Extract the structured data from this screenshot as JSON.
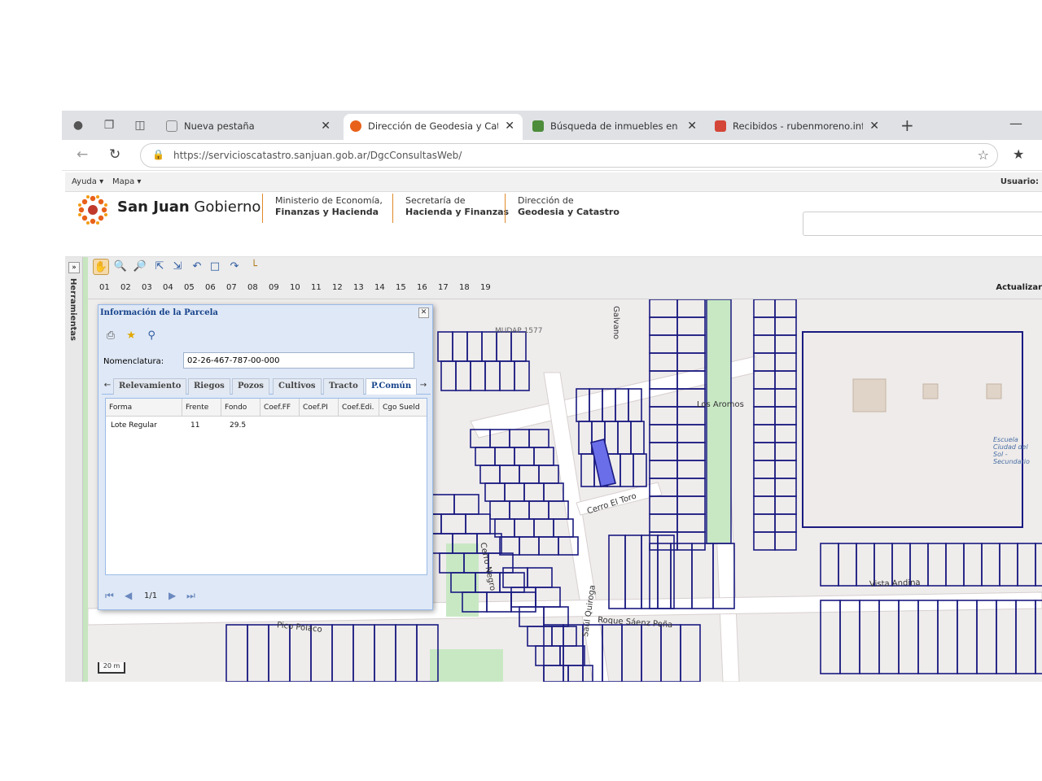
{
  "browser": {
    "tabs": [
      {
        "title": "Nueva pestaña",
        "active": false,
        "favicon_color": "#8a8a8a"
      },
      {
        "title": "Dirección de Geodesia y Catastro",
        "active": true,
        "favicon_color": "#e8611a"
      },
      {
        "title": "Búsqueda de inmuebles en mapa",
        "active": false,
        "favicon_color": "#4c8c3a"
      },
      {
        "title": "Recibidos - rubenmoreno.info@g",
        "active": false,
        "favicon_color": "#d44638"
      }
    ],
    "close_glyph": "✕",
    "new_tab_glyph": "+",
    "minimize_glyph": "—",
    "url": "https://servicioscatastro.sanjuan.gob.ar/DgcConsultasWeb/"
  },
  "menu": {
    "ayuda": "Ayuda ▾",
    "mapa": "Mapa ▾",
    "usuario": "Usuario:"
  },
  "header": {
    "brand_strong": "San Juan",
    "brand_light": "Gobierno",
    "orgs": [
      {
        "line1": "Ministerio de Economía,",
        "line2": "Finanzas y Hacienda"
      },
      {
        "line1": "Secretaría de",
        "line2": "Hacienda y Finanzas"
      },
      {
        "line1": "Dirección de",
        "line2": "Geodesia y Catastro"
      }
    ],
    "accent": "#e08a2b"
  },
  "sidebar": {
    "label": "Herramientas",
    "toggle": "»"
  },
  "toolbar": {
    "levels": [
      "01",
      "02",
      "03",
      "04",
      "05",
      "06",
      "07",
      "08",
      "09",
      "10",
      "11",
      "12",
      "13",
      "14",
      "15",
      "16",
      "17",
      "18",
      "19"
    ],
    "actualizar": "Actualizar"
  },
  "map": {
    "streets": [
      {
        "name": "Galvano"
      },
      {
        "name": "Los Aromos"
      },
      {
        "name": "Cerro El Toro"
      },
      {
        "name": "Cerro Negro"
      },
      {
        "name": "Saúl Quiroga"
      },
      {
        "name": "Roque Sáenz Peña"
      },
      {
        "name": "Pico Polaco"
      },
      {
        "name": "Vista Andina"
      },
      {
        "name": "MUDAP 1577"
      },
      {
        "name": "Escuela Ciudad del Sol - Secundario"
      }
    ],
    "scale": "20 m",
    "lot_color": "#1a1a80",
    "selected_color": "#6a6ee8"
  },
  "panel": {
    "title": "Información de la Parcela",
    "nomenclatura_label": "Nomenclatura:",
    "nomenclatura_value": "02-26-467-787-00-000",
    "tabs": [
      "Relevamiento",
      "Riegos",
      "Pozos",
      "Cultivos",
      "Tracto",
      "P.Común"
    ],
    "active_tab": "P.Común",
    "columns": [
      "Forma",
      "Frente",
      "Fondo",
      "Coef.FF",
      "Coef.PI",
      "Coef.Edi.",
      "Cgo Sueld"
    ],
    "rows": [
      {
        "forma": "Lote Regular",
        "frente": "11",
        "fondo": "29.5"
      }
    ],
    "pager": "1/1"
  }
}
